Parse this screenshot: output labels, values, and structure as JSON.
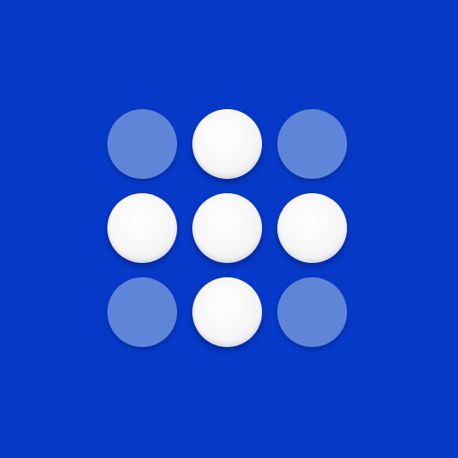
{
  "background_color": "#0639c7",
  "dots": [
    {
      "state": "dim"
    },
    {
      "state": "lit"
    },
    {
      "state": "dim"
    },
    {
      "state": "lit"
    },
    {
      "state": "lit"
    },
    {
      "state": "lit"
    },
    {
      "state": "dim"
    },
    {
      "state": "lit"
    },
    {
      "state": "dim"
    }
  ],
  "colors": {
    "lit": "#f5f5f7",
    "dim": "#5e85d8"
  }
}
